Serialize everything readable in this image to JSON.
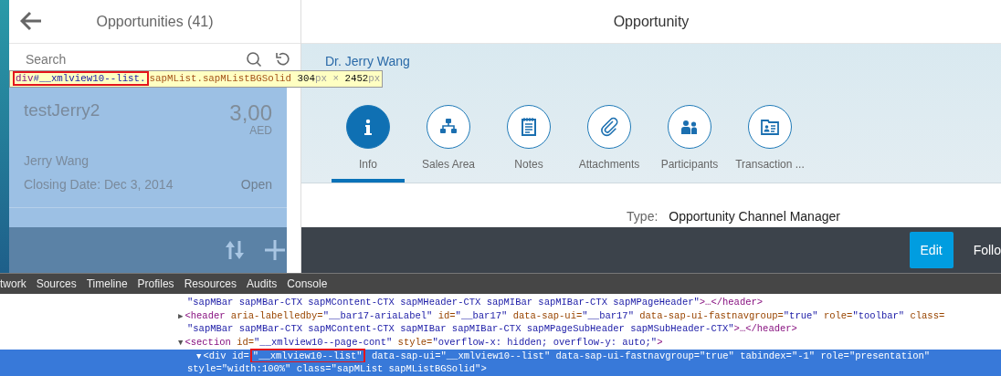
{
  "master": {
    "title": "Opportunities (41)",
    "search": {
      "placeholder": "Search"
    },
    "highlighted": true,
    "items": [
      {
        "title": "testJerry2",
        "amount": "3,00",
        "currency": "AED",
        "contact": "Jerry Wang",
        "closing": "Closing Date: Dec 3, 2014",
        "status": "Open"
      }
    ]
  },
  "detail": {
    "title": "Opportunity",
    "contact": "Dr. Jerry Wang",
    "tabs": [
      {
        "label": "Info",
        "kind": "info",
        "selected": true
      },
      {
        "label": "Sales Area",
        "kind": "hierarchy",
        "selected": false
      },
      {
        "label": "Notes",
        "kind": "notes",
        "selected": false
      },
      {
        "label": "Attachments",
        "kind": "paperclip",
        "selected": false
      },
      {
        "label": "Participants",
        "kind": "people",
        "selected": false
      },
      {
        "label": "Transaction ...",
        "kind": "card",
        "selected": false
      }
    ],
    "fields": [
      {
        "label": "Type:",
        "value": "Opportunity Channel Manager"
      }
    ],
    "footer_buttons": [
      {
        "label": "Edit",
        "kind": "emphasized"
      },
      {
        "label": "Follo",
        "kind": "plain"
      }
    ]
  },
  "tooltip": {
    "tokens": [
      {
        "kind": "tag",
        "text": "div",
        "marked": true
      },
      {
        "kind": "id",
        "text": "#__xmlview10--list.",
        "marked": true
      },
      {
        "kind": "class",
        "text": "sapMList.sapMListBGSolid",
        "marked": false
      },
      {
        "kind": "num",
        "text": " 304",
        "marked": false
      },
      {
        "kind": "unit",
        "text": "px",
        "marked": false
      },
      {
        "kind": "unit",
        "text": " × ",
        "marked": false
      },
      {
        "kind": "num",
        "text": "2452",
        "marked": false
      },
      {
        "kind": "unit",
        "text": "px",
        "marked": false
      }
    ]
  },
  "devtools": {
    "tabs": [
      "twork",
      "Sources",
      "Timeline",
      "Profiles",
      "Resources",
      "Audits",
      "Console"
    ],
    "lines": [
      {
        "selected": false,
        "tokens": [
          {
            "kind": "value",
            "text": "\"sapMBar sapMBar-CTX sapMContent-CTX sapMHeader-CTX sapMIBar sapMIBar-CTX sapMPageHeader\""
          },
          {
            "kind": "tag",
            "text": ">…</header>"
          }
        ]
      },
      {
        "selected": false,
        "tokens": [
          {
            "kind": "toggle",
            "text": "▶"
          },
          {
            "kind": "tag",
            "text": "<header"
          },
          {
            "kind": "attr",
            "text": " aria-labelledby="
          },
          {
            "kind": "value",
            "text": "\"__bar17-ariaLabel\""
          },
          {
            "kind": "attr",
            "text": " id="
          },
          {
            "kind": "value",
            "text": "\"__bar17\""
          },
          {
            "kind": "attr",
            "text": " data-sap-ui="
          },
          {
            "kind": "value",
            "text": "\"__bar17\""
          },
          {
            "kind": "attr",
            "text": " data-sap-ui-fastnavgroup="
          },
          {
            "kind": "value",
            "text": "\"true\""
          },
          {
            "kind": "attr",
            "text": " role="
          },
          {
            "kind": "value",
            "text": "\"toolbar\""
          },
          {
            "kind": "attr",
            "text": " class="
          }
        ]
      },
      {
        "selected": false,
        "tokens": [
          {
            "kind": "value",
            "text": "\"sapMBar sapMBar-CTX sapMContent-CTX sapMIBar sapMIBar-CTX sapMPageSubHeader sapMSubHeader-CTX\""
          },
          {
            "kind": "tag",
            "text": ">…</header>"
          }
        ]
      },
      {
        "selected": false,
        "tokens": [
          {
            "kind": "toggle",
            "text": "▼"
          },
          {
            "kind": "tag",
            "text": "<section"
          },
          {
            "kind": "attr",
            "text": " id="
          },
          {
            "kind": "value",
            "text": "\"__xmlview10--page-cont\""
          },
          {
            "kind": "attr",
            "text": " style="
          },
          {
            "kind": "value",
            "text": "\"overflow-x: hidden; overflow-y: auto;\""
          },
          {
            "kind": "tag",
            "text": ">"
          }
        ]
      },
      {
        "selected": true,
        "tokens": [
          {
            "kind": "toggle",
            "text": "▼"
          },
          {
            "kind": "tag",
            "text": "<div"
          },
          {
            "kind": "attr",
            "text": " id="
          },
          {
            "kind": "value",
            "text": "\"__xmlview10--list\"",
            "marked": true
          },
          {
            "kind": "attr",
            "text": " data-sap-ui="
          },
          {
            "kind": "value",
            "text": "\"__xmlview10--list\""
          },
          {
            "kind": "attr",
            "text": " data-sap-ui-fastnavgroup="
          },
          {
            "kind": "value",
            "text": "\"true\""
          },
          {
            "kind": "attr",
            "text": " tabindex="
          },
          {
            "kind": "value",
            "text": "\"-1\""
          },
          {
            "kind": "attr",
            "text": " role="
          },
          {
            "kind": "value",
            "text": "\"presentation\""
          }
        ]
      },
      {
        "selected": true,
        "tokens": [
          {
            "kind": "attr",
            "text": "style="
          },
          {
            "kind": "value",
            "text": "\"width:100%\""
          },
          {
            "kind": "attr",
            "text": " class="
          },
          {
            "kind": "value",
            "text": "\"sapMList sapMListBGSolid\""
          },
          {
            "kind": "tag",
            "text": ">"
          }
        ]
      }
    ]
  }
}
